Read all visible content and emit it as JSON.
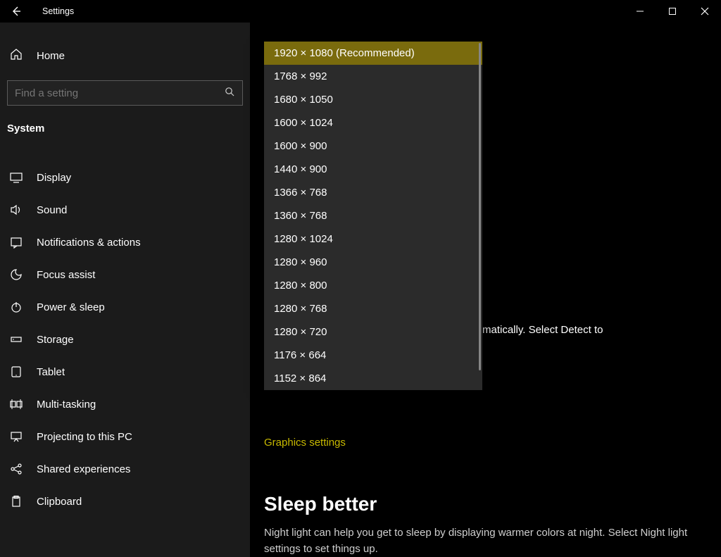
{
  "title_bar": {
    "title": "Settings"
  },
  "sidebar": {
    "home": "Home",
    "search_placeholder": "Find a setting",
    "category": "System",
    "items": [
      {
        "label": "Display"
      },
      {
        "label": "Sound"
      },
      {
        "label": "Notifications & actions"
      },
      {
        "label": "Focus assist"
      },
      {
        "label": "Power & sleep"
      },
      {
        "label": "Storage"
      },
      {
        "label": "Tablet"
      },
      {
        "label": "Multi-tasking"
      },
      {
        "label": "Projecting to this PC"
      },
      {
        "label": "Shared experiences"
      },
      {
        "label": "Clipboard"
      }
    ]
  },
  "dropdown": {
    "options": [
      "1920 × 1080 (Recommended)",
      "1768 × 992",
      "1680 × 1050",
      "1600 × 1024",
      "1600 × 900",
      "1440 × 900",
      "1366 × 768",
      "1360 × 768",
      "1280 × 1024",
      "1280 × 960",
      "1280 × 800",
      "1280 × 768",
      "1280 × 720",
      "1176 × 664",
      "1152 × 864"
    ],
    "selected_index": 0
  },
  "main": {
    "bg_text_fragment": "matically. Select Detect to",
    "graphics_link": "Graphics settings",
    "sleep_title": "Sleep better",
    "sleep_body": "Night light can help you get to sleep by displaying warmer colors at night. Select Night light settings to set things up."
  }
}
